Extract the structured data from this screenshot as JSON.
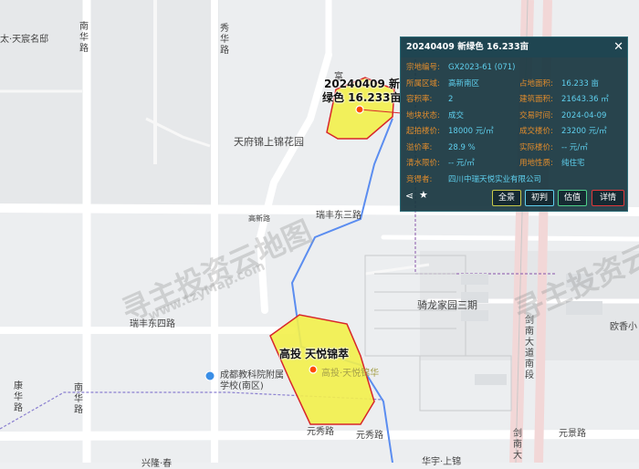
{
  "map": {
    "streets": {
      "nanhua_lu_top": "南华路",
      "xiuhua_lu": "秀华路",
      "ruifeng_dong_san_lu": "瑞丰东三路",
      "ruifeng_dong_si_lu": "瑞丰东四路",
      "nanhua_lu_bottom": "南华路",
      "kanghua_lu": "康华路",
      "yuanxiu_lu_1": "元秀路",
      "yuanxiu_lu_2": "元秀路",
      "yuanjing_lu": "元景路",
      "jiannan_dadao_nanduan": "剑南大道南段",
      "jiannan_da": "剑南大",
      "gaoxinlu": "高新路"
    },
    "places": {
      "taishangmingfu": "太·天宸名邸",
      "tianfu_jinshang_jinhuayuan": "天府锦上锦花园",
      "qilong_jiayuan": "骑龙家园三期",
      "school_line1": "成都教科院附属",
      "school_line2": "学校(南区)",
      "ouxiang": "欧香小",
      "fu": "富",
      "bottom_partial_1": "华宇·上锦",
      "bottom_partial_2": "兴隆·春"
    },
    "plots": {
      "north_label_line1": "20240409 新",
      "north_label_line2": "绿色 16.233亩",
      "south_label": "高投 天悦锦萃",
      "south_sub_label": "高投·天悦锦华"
    },
    "watermark": {
      "text1": "寻主投资云地图",
      "url": "www.tzyMap.com",
      "text2": "寻主投资云地"
    },
    "colors": {
      "plot_fill": "#f3f04a",
      "plot_border": "#d8262a",
      "popup_label": "#e28c2c",
      "popup_value": "#5fd0ee"
    }
  },
  "popup": {
    "title": "20240409 新绿色 16.233亩",
    "close_icon": "close-icon",
    "rows": [
      {
        "l1": "宗地编号:",
        "v1": "GX2023-61 (071)",
        "l2": "",
        "v2": ""
      },
      {
        "l1": "所属区域:",
        "v1": "高新南区",
        "l2": "占地面积:",
        "v2": "16.233 亩"
      },
      {
        "l1": "容积率:",
        "v1": "2",
        "l2": "建筑面积:",
        "v2": "21643.36 ㎡"
      },
      {
        "l1": "地块状态:",
        "v1": "成交",
        "l2": "交易时间:",
        "v2": "2024-04-09"
      },
      {
        "l1": "起拍楼价:",
        "v1": "18000 元/㎡",
        "l2": "成交楼价:",
        "v2": "23200 元/㎡"
      },
      {
        "l1": "溢价率:",
        "v1": "28.9 %",
        "l2": "实际楼价:",
        "v2": "-- 元/㎡"
      },
      {
        "l1": "清水限价:",
        "v1": "-- 元/㎡",
        "l2": "用地性质:",
        "v2": "纯住宅"
      },
      {
        "l1": "竞得者:",
        "v1": "四川中瑞天悦实业有限公司",
        "l2": "",
        "v2": ""
      }
    ],
    "buttons": {
      "all": "全景",
      "prelim": "初判",
      "valuation": "估值",
      "detail": "详情"
    },
    "icons": {
      "share": "share-icon",
      "favorite": "star-icon"
    }
  }
}
